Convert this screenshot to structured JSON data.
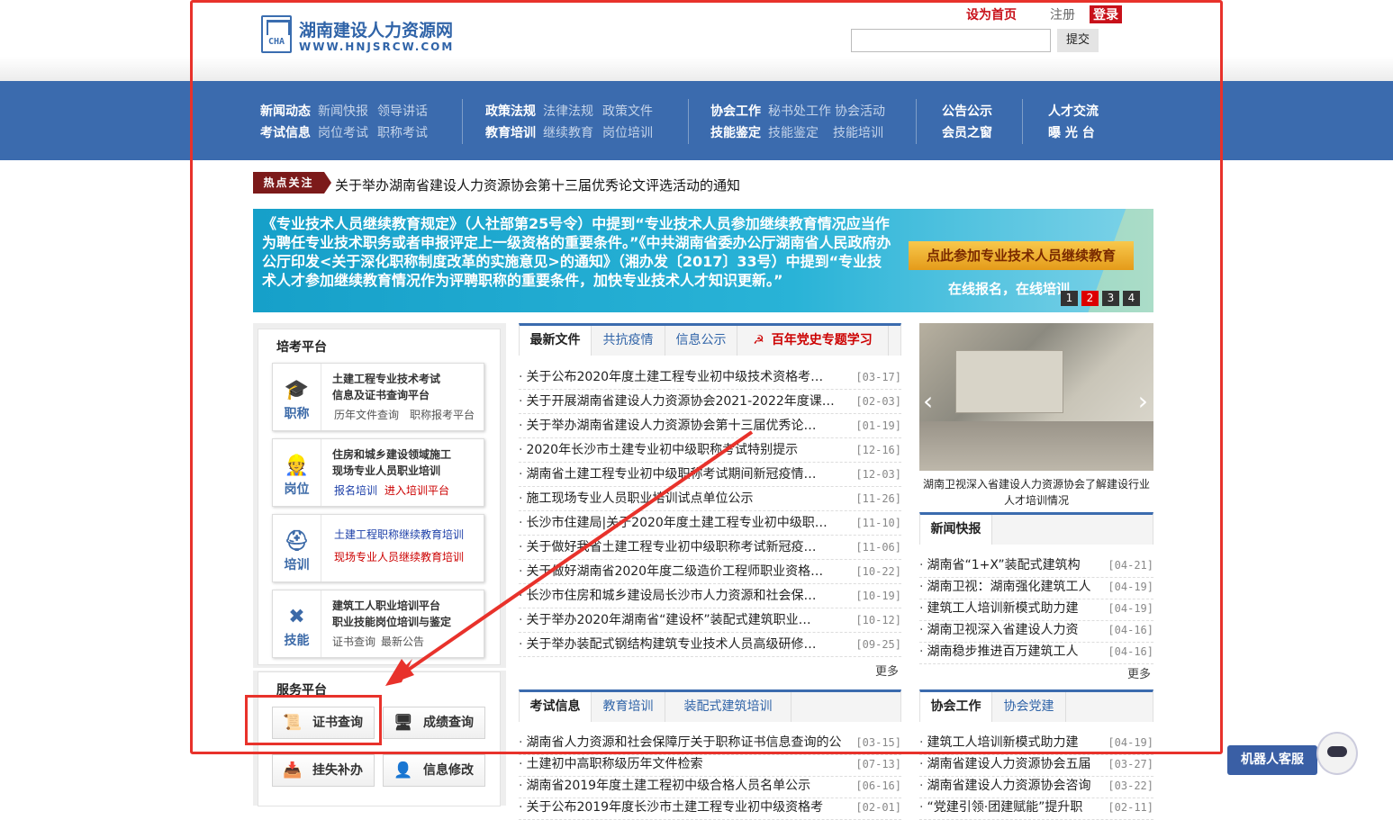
{
  "header": {
    "logo_cn": "湖南建设人力资源网",
    "logo_en": "WWW.HNJSRCW.COM",
    "logo_abbr": "CHA",
    "set_home": "设为首页",
    "register": "注册",
    "login": "登录",
    "search_placeholder": "",
    "submit": "提交"
  },
  "nav": {
    "groups": [
      {
        "rows": [
          {
            "main": "新闻动态",
            "subs": [
              "新闻快报",
              "领导讲话"
            ]
          },
          {
            "main": "考试信息",
            "subs": [
              "岗位考试",
              "职称考试"
            ]
          }
        ]
      },
      {
        "rows": [
          {
            "main": "政策法规",
            "subs": [
              "法律法规",
              "政策文件"
            ]
          },
          {
            "main": "教育培训",
            "subs": [
              "继续教育",
              "岗位培训"
            ]
          }
        ]
      },
      {
        "rows": [
          {
            "main": "协会工作",
            "subs": [
              "秘书处工作",
              "协会活动"
            ]
          },
          {
            "main": "技能鉴定",
            "subs": [
              "技能鉴定",
              "技能培训"
            ]
          }
        ]
      },
      {
        "rows": [
          {
            "main": "公告公示",
            "subs": []
          },
          {
            "main": "会员之窗",
            "subs": []
          }
        ]
      },
      {
        "rows": [
          {
            "main": "人才交流",
            "subs": []
          },
          {
            "main": "曝 光 台",
            "subs": []
          }
        ]
      }
    ]
  },
  "hot": {
    "tag": "热点关注",
    "text": "关于举办湖南省建设人力资源协会第十三届优秀论文评选活动的通知"
  },
  "banner": {
    "text": "《专业技术人员继续教育规定》（人社部第25号令）中提到“专业技术人员参加继续教育情况应当作为聘任专业技术职务或者申报评定上一级资格的重要条件。”《中共湖南省委办公厅湖南省人民政府办公厅印发<关于深化职称制度改革的实施意见>的通知》（湘办发〔2017〕33号）中提到“专业技术人才参加继续教育情况作为评聘职称的重要条件，加快专业技术人才知识更新。”",
    "button": "点此参加专业技术人员继续教育",
    "sub": "在线报名，在线培训",
    "dots": [
      "1",
      "2",
      "3",
      "4"
    ],
    "active_dot": 1
  },
  "left": {
    "title": "培考平台",
    "cards": [
      {
        "icon": "graduation-cap-icon",
        "icon_label": "职称",
        "title1": "土建工程专业技术考试",
        "title2": "信息及证书查询平台",
        "link1": "历年文件查询",
        "link2": "职称报考平台"
      },
      {
        "icon": "worker-icon",
        "icon_label": "岗位",
        "title1": "住房和城乡建设领域施工",
        "title2": "现场专业人员职业培训",
        "link1": "报名培训",
        "link2": "进入培训平台"
      },
      {
        "icon": "helmet-icon",
        "icon_label": "培训",
        "link1": "土建工程职称继续教育培训",
        "link2": "现场专业人员继续教育培训"
      },
      {
        "icon": "tools-icon",
        "icon_label": "技能",
        "title1": "建筑工人职业培训平台",
        "title2": "职业技能岗位培训与鉴定",
        "link1": "证书查询",
        "link2": "最新公告"
      }
    ]
  },
  "service": {
    "title": "服务平台",
    "buttons": [
      "证书查询",
      "成绩查询",
      "挂失补办",
      "信息修改"
    ]
  },
  "news": {
    "tabs": [
      "最新文件",
      "共抗疫情",
      "信息公示",
      "百年党史专题学习"
    ],
    "items": [
      {
        "title": "关于公布2020年度土建工程专业初中级技术资格考…",
        "date": "[03-17]"
      },
      {
        "title": "关于开展湖南省建设人力资源协会2021-2022年度课…",
        "date": "[02-03]"
      },
      {
        "title": "关于举办湖南省建设人力资源协会第十三届优秀论…",
        "date": "[01-19]"
      },
      {
        "title": "2020年长沙市土建专业初中级职称考试特别提示",
        "date": "[12-16]"
      },
      {
        "title": "湖南省土建工程专业初中级职称考试期间新冠疫情…",
        "date": "[12-03]"
      },
      {
        "title": "施工现场专业人员职业培训试点单位公示",
        "date": "[11-26]"
      },
      {
        "title": "长沙市住建局|关于2020年度土建工程专业初中级职…",
        "date": "[11-10]"
      },
      {
        "title": "关于做好我省土建工程专业初中级职称考试新冠疫…",
        "date": "[11-06]"
      },
      {
        "title": "关于做好湖南省2020年度二级造价工程师职业资格…",
        "date": "[10-22]"
      },
      {
        "title": "长沙市住房和城乡建设局长沙市人力资源和社会保…",
        "date": "[10-19]"
      },
      {
        "title": "关于举办2020年湖南省“建设杯”装配式建筑职业…",
        "date": "[10-12]"
      },
      {
        "title": "关于举办装配式钢结构建筑专业技术人员高级研修…",
        "date": "[09-25]"
      }
    ],
    "more": "更多"
  },
  "exam": {
    "tabs": [
      "考试信息",
      "教育培训",
      "装配式建筑培训"
    ],
    "items": [
      {
        "title": "湖南省人力资源和社会保障厅关于职称证书信息查询的公",
        "date": "[03-15]"
      },
      {
        "title": "土建初中高职称级历年文件检索",
        "date": "[07-13]"
      },
      {
        "title": "湖南省2019年度土建工程初中级合格人员名单公示",
        "date": "[06-16]"
      },
      {
        "title": "关于公布2019年度长沙市土建工程专业初中级资格考",
        "date": "[02-01]"
      }
    ]
  },
  "photo": {
    "caption": "湖南卫视深入省建设人力资源协会了解建设行业人才培训情况"
  },
  "flash": {
    "title": "新闻快报",
    "items": [
      {
        "title": "湖南省“1+X”装配式建筑构",
        "date": "[04-21]"
      },
      {
        "title": "湖南卫视：湖南强化建筑工人",
        "date": "[04-19]"
      },
      {
        "title": "建筑工人培训新模式助力建",
        "date": "[04-19]"
      },
      {
        "title": "湖南卫视深入省建设人力资",
        "date": "[04-16]"
      },
      {
        "title": "湖南稳步推进百万建筑工人",
        "date": "[04-16]"
      }
    ],
    "more": "更多"
  },
  "assoc": {
    "tabs": [
      "协会工作",
      "协会党建"
    ],
    "items": [
      {
        "title": "建筑工人培训新模式助力建",
        "date": "[04-19]"
      },
      {
        "title": "湖南省建设人力资源协会五届",
        "date": "[03-27]"
      },
      {
        "title": "湖南省建设人力资源协会咨询",
        "date": "[03-22]"
      },
      {
        "title": "“党建引领·团建赋能”提升职",
        "date": "[02-11]"
      }
    ]
  },
  "robot": {
    "label": "机器人客服"
  },
  "colors": {
    "nav": "#3b6bae",
    "annotation": "#e8322b",
    "hot": "#7c1a1a"
  }
}
